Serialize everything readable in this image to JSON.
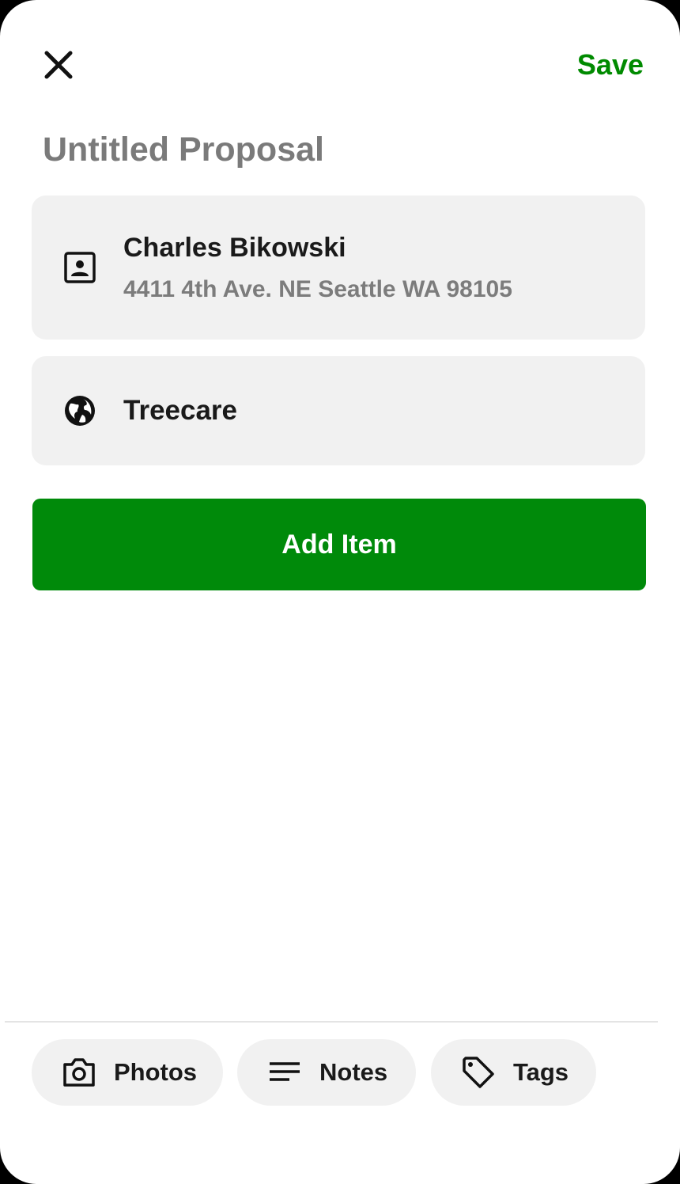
{
  "header": {
    "save_label": "Save",
    "close_icon": "close-icon"
  },
  "proposal": {
    "title": "Untitled Proposal"
  },
  "client": {
    "icon": "contact-card-icon",
    "name": "Charles Bikowski",
    "address": "4411 4th Ave. NE Seattle WA 98105"
  },
  "service": {
    "icon": "globe-icon",
    "name": "Treecare"
  },
  "actions": {
    "add_item_label": "Add Item"
  },
  "bottom_bar": {
    "photos_label": "Photos",
    "notes_label": "Notes",
    "tags_label": "Tags"
  },
  "colors": {
    "accent": "#008a00",
    "card_bg": "#f1f1f1",
    "title_gray": "#7a7a7a"
  }
}
